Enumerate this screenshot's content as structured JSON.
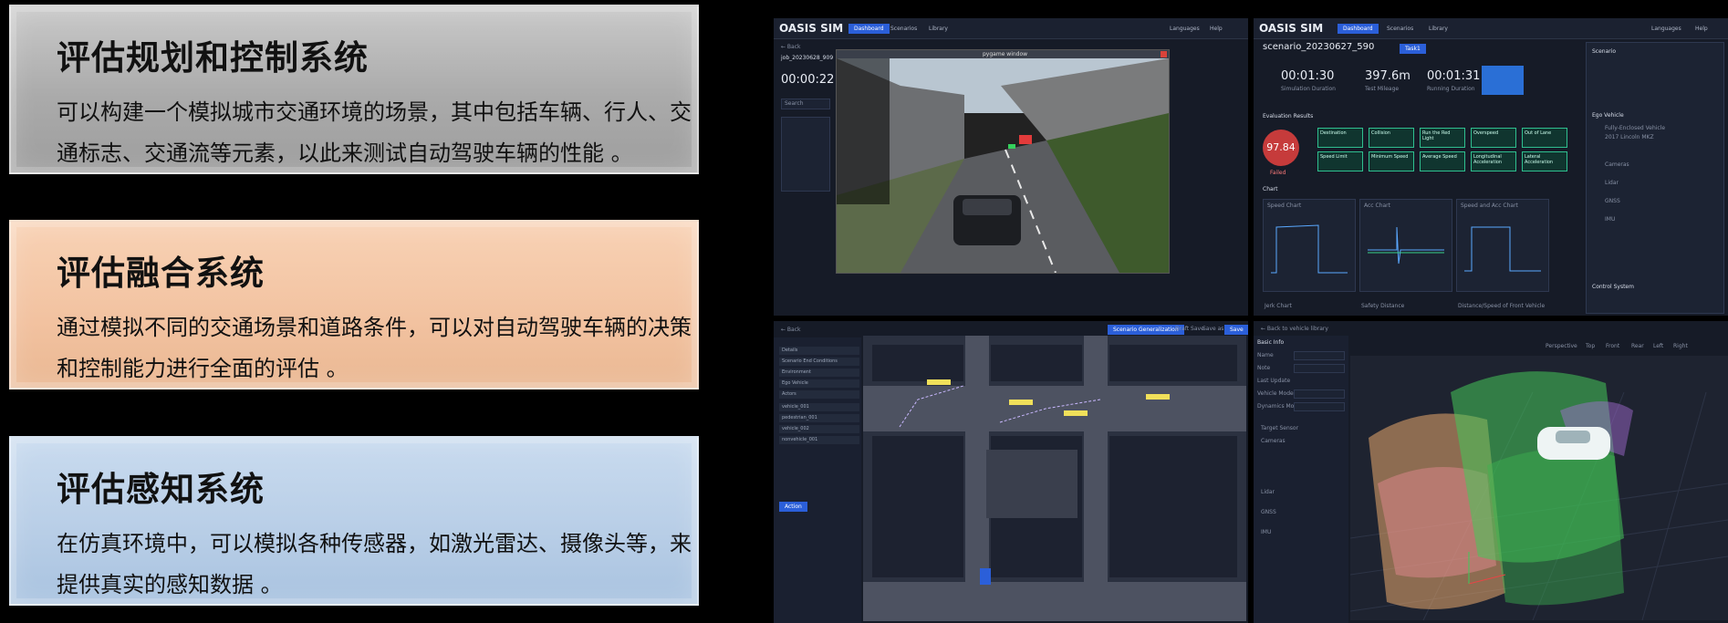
{
  "cards": [
    {
      "title": "评估规划和控制系统",
      "body": "可以构建一个模拟城市交通环境的场景，其中包括车辆、行人、交通标志、交通流等元素，以此来测试自动驾驶车辆的性能 。"
    },
    {
      "title": "评估融合系统",
      "body": "通过模拟不同的交通场景和道路条件，可以对自动驾驶车辆的决策和控制能力进行全面的评估 。"
    },
    {
      "title": "评估感知系统",
      "body": "在仿真环境中，可以模拟各种传感器，如激光雷达、摄像头等，来提供真实的感知数据 。"
    }
  ],
  "app": {
    "logo": "OASIS SIM",
    "tabs": [
      "Dashboard",
      "Scenarios",
      "Library"
    ],
    "top_right": [
      "Languages",
      "Help"
    ]
  },
  "sim_panel": {
    "back": "← Back",
    "job": "job_20230628_909",
    "timer": "00:00:22",
    "window_title": "pygame window",
    "search": "Search"
  },
  "report_panel": {
    "scenario": "scenario_20230627_590",
    "badge": "Task1",
    "stats": [
      {
        "value": "00:01:30",
        "label": "Simulation Duration"
      },
      {
        "value": "397.6m",
        "label": "Test Mileage"
      },
      {
        "value": "00:01:31",
        "label": "Running Duration"
      }
    ],
    "evaluation_title": "Evaluation Results",
    "score": "97.84",
    "score_status": "Failed",
    "metrics": [
      "Destination",
      "Collision",
      "Run the Red Light",
      "Overspeed",
      "Out of Lane",
      "Speed Limit",
      "Minimum Speed",
      "Average Speed",
      "Longitudinal Acceleration",
      "Lateral Acceleration"
    ],
    "chart_title": "Chart",
    "charts": [
      "Speed Chart",
      "Acc Chart",
      "Speed and Acc Chart"
    ],
    "bottom_charts": [
      "Jerk Chart",
      "Safety Distance",
      "Distance/Speed of Front Vehicle"
    ],
    "side_sections": [
      "Scenario",
      "Ego Vehicle",
      "Control System"
    ],
    "ego": [
      "Fully-Enclosed Vehicle",
      "2017 Lincoln MKZ"
    ],
    "sensors": [
      "Cameras",
      "Lidar",
      "GNSS",
      "IMU"
    ]
  },
  "editor_panel": {
    "back": "← Back",
    "tree": [
      "Details",
      "Scenario End Conditions",
      "Environment",
      "Ego Vehicle",
      "Actors",
      "vehicle_001",
      "pedestrian_001",
      "vehicle_002",
      "nonvehicle_001"
    ],
    "actions": [
      "Scenario Generalization",
      "Draft Save",
      "Save as",
      "Save"
    ]
  },
  "sensor_panel": {
    "back": "← Back to vehicle library",
    "section": "Basic Info",
    "fields": [
      "Name",
      "Note",
      "Last Update",
      "Vehicle Model",
      "Dynamics Model"
    ],
    "sensor_groups": [
      "Target Sensor",
      "Cameras",
      "Lidar",
      "GNSS",
      "IMU"
    ],
    "views": [
      "Perspective",
      "Top",
      "Front",
      "Rear",
      "Left",
      "Right"
    ]
  }
}
